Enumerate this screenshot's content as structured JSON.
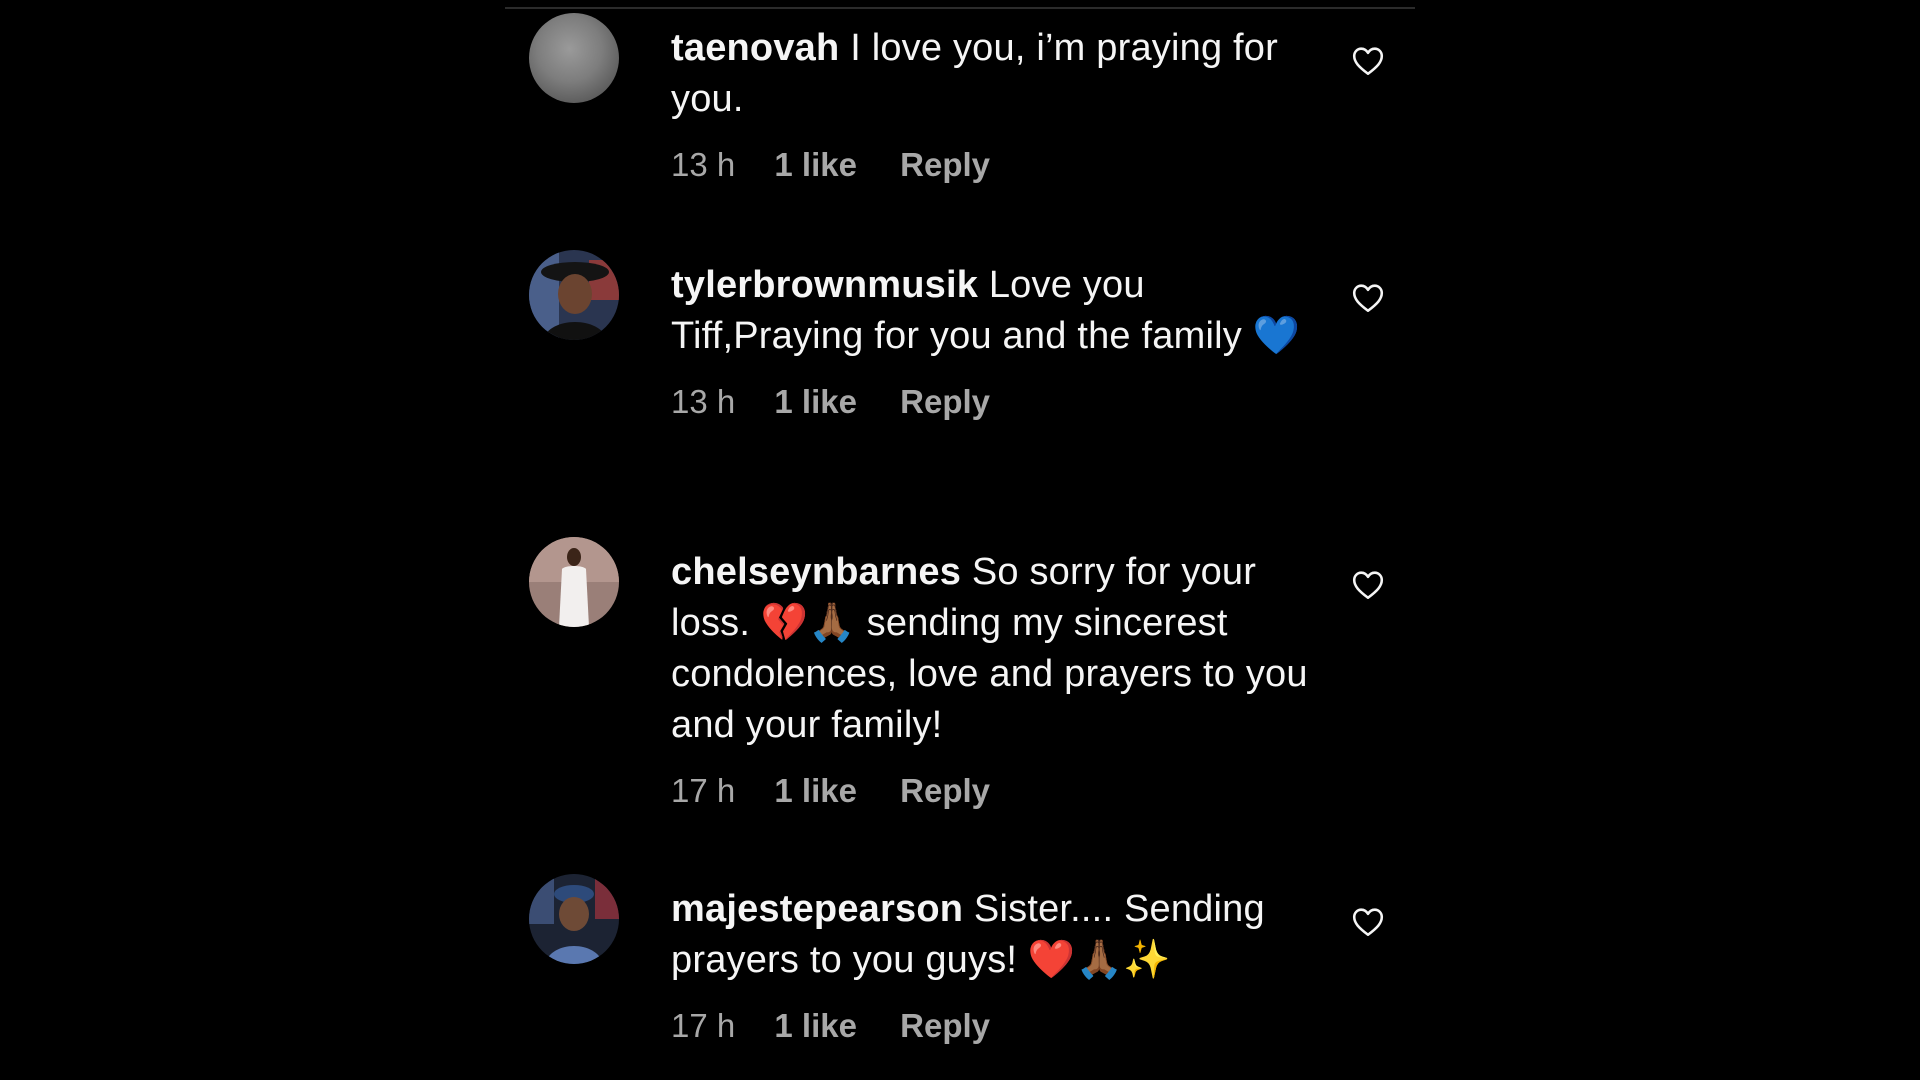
{
  "comments": [
    {
      "username": "taenovah",
      "text": " I love you, i’m praying for you.",
      "time": "13 h",
      "likes": "1 like",
      "reply": "Reply",
      "avatar": "blurred-gray-avatar"
    },
    {
      "username": "tylerbrownmusik",
      "text": " Love you Tiff,Praying for you and the family 💙",
      "time": "13 h",
      "likes": "1 like",
      "reply": "Reply",
      "avatar": "person-with-hat-avatar"
    },
    {
      "username": "chelseynbarnes",
      "text": " So sorry for your loss. 💔🙏🏾 sending my sincerest condolences, love and prayers to you and your family!",
      "time": "17 h",
      "likes": "1 like",
      "reply": "Reply",
      "avatar": "person-in-white-dress-avatar"
    },
    {
      "username": "majestepearson",
      "text": " Sister.... Sending prayers to you guys! ❤️🙏🏾✨",
      "time": "17 h",
      "likes": "1 like",
      "reply": "Reply",
      "avatar": "person-with-cap-avatar"
    }
  ],
  "colors": {
    "background": "#000000",
    "primary_text": "#f5f5f5",
    "secondary_text": "#a8a8a8"
  },
  "icons": {
    "like": "heart-outline-icon"
  }
}
